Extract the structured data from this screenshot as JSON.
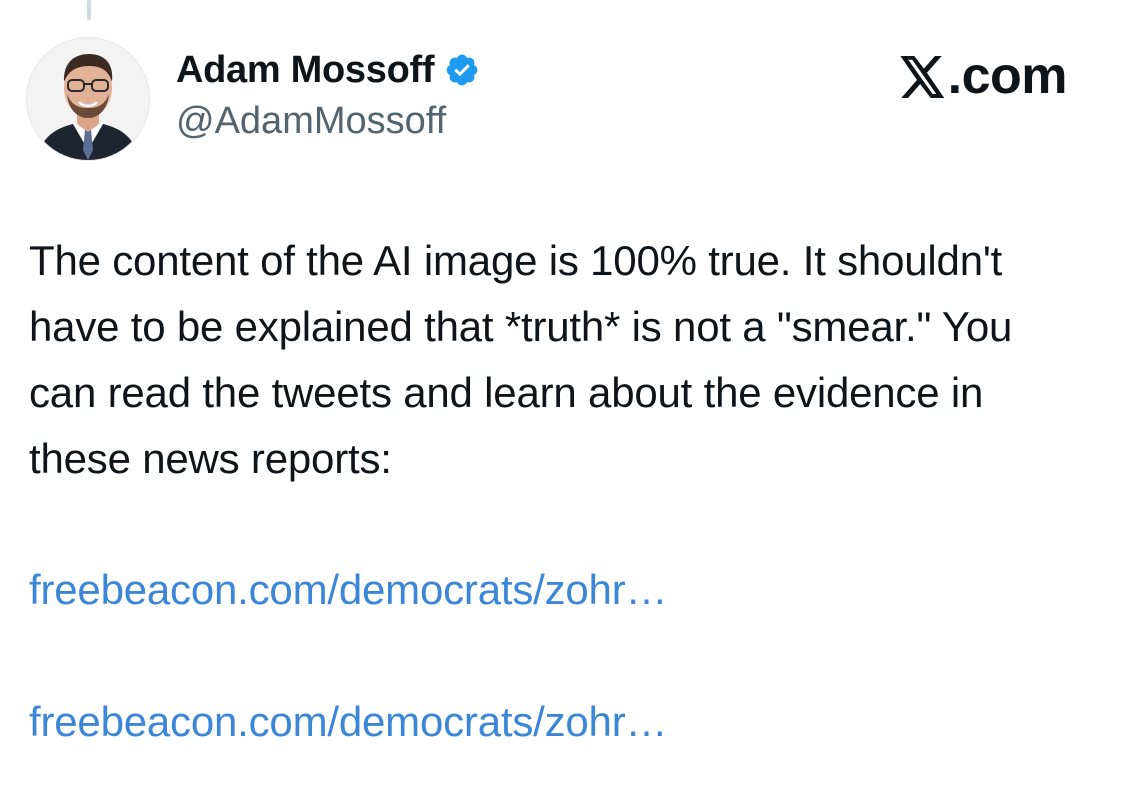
{
  "author": {
    "display_name": "Adam Mossoff",
    "handle": "@AdamMossoff",
    "verified": true,
    "verified_icon": "verified-badge-icon",
    "avatar_icon": "profile-photo"
  },
  "brand": {
    "label": ".com",
    "icon": "x-logo-icon"
  },
  "tweet": {
    "text": "The content of the AI image is 100% true. It shouldn't have to be explained that *truth* is not a \"smear.\" You can read the tweets and learn about the evidence in these news reports:",
    "links": [
      "freebeacon.com/democrats/zohr…",
      "freebeacon.com/democrats/zohr…"
    ]
  },
  "colors": {
    "text": "#0f1419",
    "secondary": "#536471",
    "link": "#3b86d6",
    "verified": "#1d9bf0"
  }
}
